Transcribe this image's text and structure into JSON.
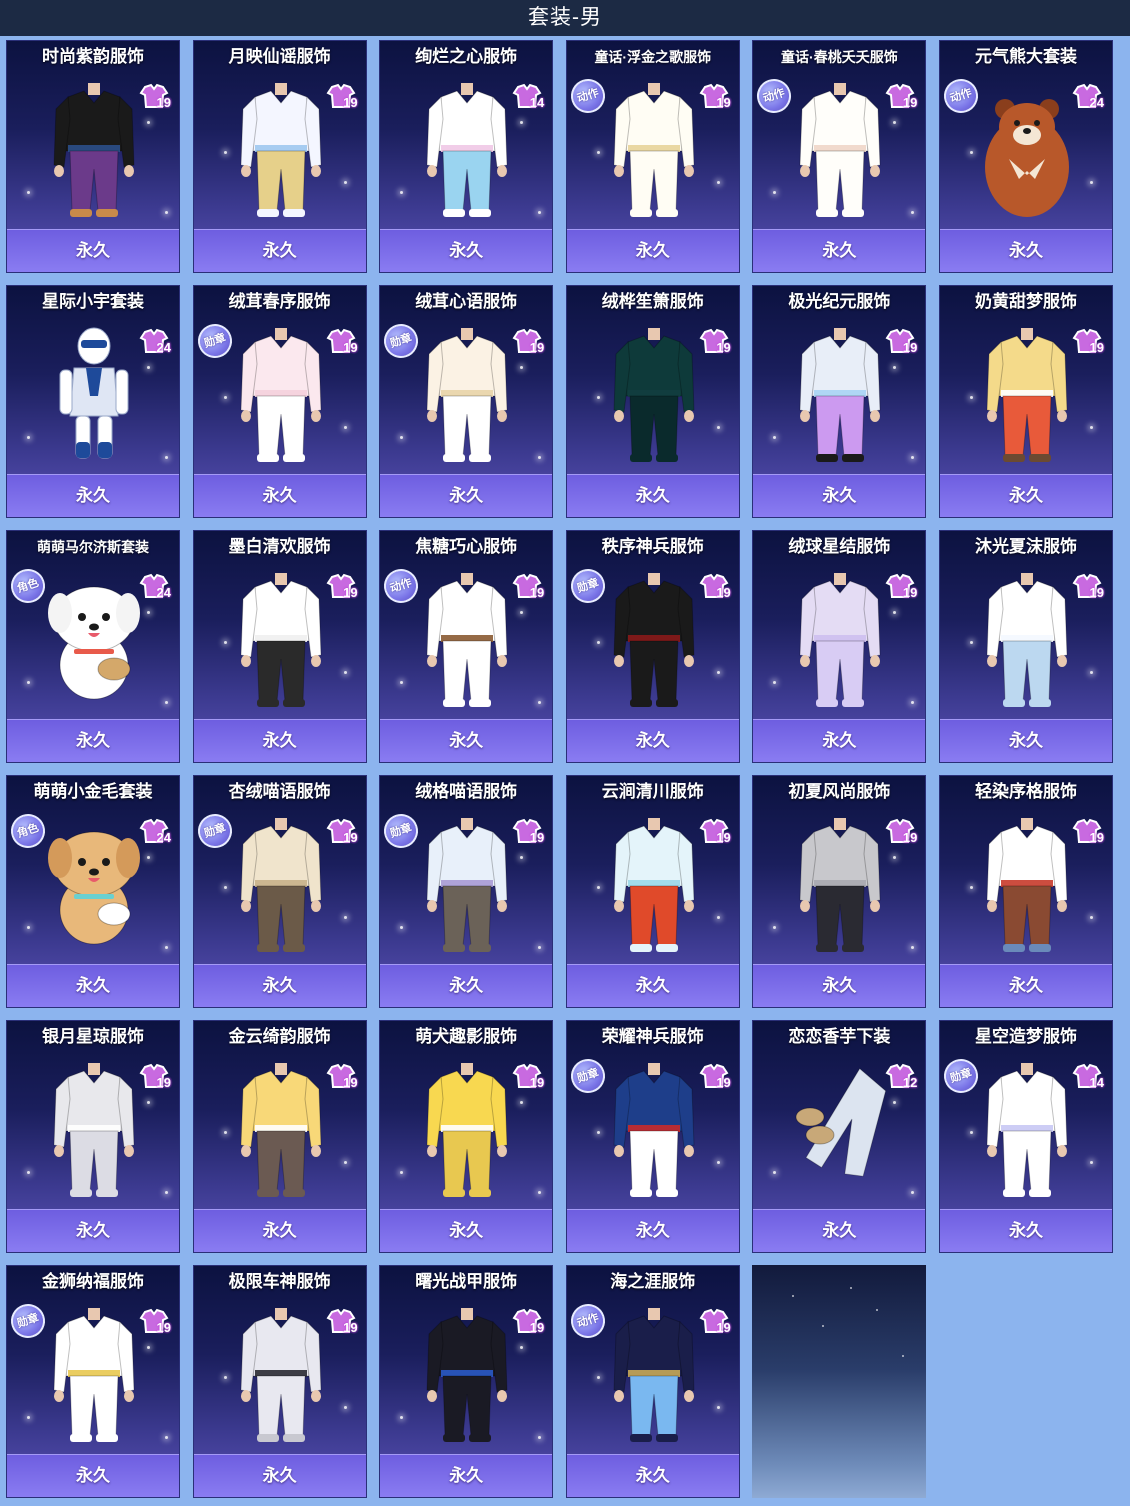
{
  "header": {
    "title": "套装-男"
  },
  "colors": {
    "background": "#8cb4ee",
    "header": "#1c2a44",
    "card_top": "#0c1240",
    "card_bottom": "#5a52b4",
    "footer": "#7d6ee8"
  },
  "items": [
    {
      "name": "时尚紫韵服饰",
      "level": "19",
      "badge": "",
      "status": "永久",
      "colors": [
        "#1a1a1a",
        "#2b4f8a",
        "#6b3a8a",
        "#c98a4a"
      ],
      "icon": "outfit-icon"
    },
    {
      "name": "月映仙谣服饰",
      "level": "19",
      "badge": "",
      "status": "永久",
      "colors": [
        "#f4f6ff",
        "#9fc8f0",
        "#e6d08a",
        "#f4f6ff"
      ],
      "icon": "outfit-icon"
    },
    {
      "name": "绚烂之心服饰",
      "level": "14",
      "badge": "",
      "status": "永久",
      "colors": [
        "#ffffff",
        "#f0c8e6",
        "#9ad4f0",
        "#ffffff"
      ],
      "icon": "outfit-icon"
    },
    {
      "name": "童话·浮金之歌服饰",
      "level": "19",
      "badge": "动作",
      "status": "永久",
      "colors": [
        "#fffdf4",
        "#e8d49a",
        "#fffdf4",
        "#fffdf4"
      ],
      "icon": "outfit-icon"
    },
    {
      "name": "童话·春桃夭夭服饰",
      "level": "19",
      "badge": "动作",
      "status": "永久",
      "colors": [
        "#fffefa",
        "#f0d6c8",
        "#fffefa",
        "#fffefa"
      ],
      "icon": "outfit-icon"
    },
    {
      "name": "元气熊大套装",
      "level": "24",
      "badge": "动作",
      "status": "永久",
      "colors": [
        "#b8582a",
        "#f4e6d4",
        "#8a3e1c",
        "#8a3e1c"
      ],
      "icon": "bear-icon"
    },
    {
      "name": "星际小宇套装",
      "level": "24",
      "badge": "",
      "status": "永久",
      "colors": [
        "#ffffff",
        "#1e4a9a",
        "#dfe6f4",
        "#1e4a9a"
      ],
      "icon": "robot-icon"
    },
    {
      "name": "绒茸春序服饰",
      "level": "19",
      "badge": "勋章",
      "status": "永久",
      "colors": [
        "#fbe8ee",
        "#f4d0dc",
        "#ffffff",
        "#ffffff"
      ],
      "icon": "outfit-icon"
    },
    {
      "name": "绒茸心语服饰",
      "level": "19",
      "badge": "勋章",
      "status": "永久",
      "colors": [
        "#fbf2e4",
        "#e8d4a8",
        "#ffffff",
        "#ffffff"
      ],
      "icon": "outfit-icon"
    },
    {
      "name": "绒桦笙箫服饰",
      "level": "19",
      "badge": "",
      "status": "永久",
      "colors": [
        "#0e3a3a",
        "#123e40",
        "#0a2a2c",
        "#0a2a2c"
      ],
      "icon": "outfit-icon"
    },
    {
      "name": "极光纪元服饰",
      "level": "19",
      "badge": "",
      "status": "永久",
      "colors": [
        "#e8eef8",
        "#a8d4f4",
        "#cc9af0",
        "#1a1a1a"
      ],
      "icon": "outfit-icon"
    },
    {
      "name": "奶黄甜梦服饰",
      "level": "19",
      "badge": "",
      "status": "永久",
      "colors": [
        "#f4da8a",
        "#ffffff",
        "#e85a3a",
        "#6b4a32"
      ],
      "icon": "outfit-icon"
    },
    {
      "name": "萌萌马尔济斯套装",
      "level": "24",
      "badge": "角色",
      "status": "永久",
      "colors": [
        "#ffffff",
        "#f4f4f4",
        "#e85a4a",
        "#d4a86a"
      ],
      "icon": "dog-icon"
    },
    {
      "name": "墨白清欢服饰",
      "level": "19",
      "badge": "",
      "status": "永久",
      "colors": [
        "#ffffff",
        "#f0f0f0",
        "#2a2a2a",
        "#2a2a2a"
      ],
      "icon": "outfit-icon"
    },
    {
      "name": "焦糖巧心服饰",
      "level": "19",
      "badge": "动作",
      "status": "永久",
      "colors": [
        "#ffffff",
        "#8a5a32",
        "#ffffff",
        "#ffffff"
      ],
      "icon": "outfit-icon"
    },
    {
      "name": "秩序神兵服饰",
      "level": "19",
      "badge": "勋章",
      "status": "永久",
      "colors": [
        "#1a1a1a",
        "#8a1a1a",
        "#1a1a1a",
        "#1a1a1a"
      ],
      "icon": "outfit-icon"
    },
    {
      "name": "绒球星结服饰",
      "level": "19",
      "badge": "",
      "status": "永久",
      "colors": [
        "#e4dcf4",
        "#cdbff0",
        "#d8ccf4",
        "#d8ccf4"
      ],
      "icon": "outfit-icon"
    },
    {
      "name": "沐光夏沫服饰",
      "level": "19",
      "badge": "",
      "status": "永久",
      "colors": [
        "#ffffff",
        "#f4f8ff",
        "#bcd8f0",
        "#bcd8f0"
      ],
      "icon": "outfit-icon"
    },
    {
      "name": "萌萌小金毛套装",
      "level": "24",
      "badge": "角色",
      "status": "永久",
      "colors": [
        "#e8b87a",
        "#d49a5a",
        "#6ad0d0",
        "#ffffff"
      ],
      "icon": "dog-icon"
    },
    {
      "name": "杏绒喵语服饰",
      "level": "19",
      "badge": "勋章",
      "status": "永久",
      "colors": [
        "#f0e4cc",
        "#c8b08a",
        "#6b5a48",
        "#6b5a48"
      ],
      "icon": "outfit-icon"
    },
    {
      "name": "绒格喵语服饰",
      "level": "19",
      "badge": "勋章",
      "status": "永久",
      "colors": [
        "#e8f0fa",
        "#a89ad4",
        "#6b6258",
        "#6b6258"
      ],
      "icon": "outfit-icon"
    },
    {
      "name": "云涧清川服饰",
      "level": "19",
      "badge": "",
      "status": "永久",
      "colors": [
        "#e4f4fa",
        "#9ad8e8",
        "#e04a2a",
        "#e4f4fa"
      ],
      "icon": "outfit-icon"
    },
    {
      "name": "初夏风尚服饰",
      "level": "19",
      "badge": "",
      "status": "永久",
      "colors": [
        "#c8c8cc",
        "#a8a8b0",
        "#2a2a32",
        "#2a2a32"
      ],
      "icon": "outfit-icon"
    },
    {
      "name": "轻染序格服饰",
      "level": "19",
      "badge": "",
      "status": "永久",
      "colors": [
        "#ffffff",
        "#c83a2a",
        "#8a4a32",
        "#6a8aba"
      ],
      "icon": "outfit-icon"
    },
    {
      "name": "银月星琼服饰",
      "level": "19",
      "badge": "",
      "status": "永久",
      "colors": [
        "#e8e8ec",
        "#ffffff",
        "#dcdce4",
        "#dcdce4"
      ],
      "icon": "outfit-icon"
    },
    {
      "name": "金云绮韵服饰",
      "level": "19",
      "badge": "",
      "status": "永久",
      "colors": [
        "#f8d878",
        "#ffffff",
        "#6b5a52",
        "#6b5a52"
      ],
      "icon": "outfit-icon"
    },
    {
      "name": "萌犬趣影服饰",
      "level": "19",
      "badge": "",
      "status": "永久",
      "colors": [
        "#f8d850",
        "#ffffff",
        "#e8c850",
        "#e8c850"
      ],
      "icon": "outfit-icon"
    },
    {
      "name": "荣耀神兵服饰",
      "level": "19",
      "badge": "勋章",
      "status": "永久",
      "colors": [
        "#1e3e8a",
        "#c82a2a",
        "#ffffff",
        "#ffffff"
      ],
      "icon": "outfit-icon"
    },
    {
      "name": "恋恋香芋下装",
      "level": "12",
      "badge": "",
      "status": "永久",
      "colors": [
        "#dce4f0",
        "#c8a878",
        "#dce4f0",
        "#c8a878"
      ],
      "icon": "pants-icon"
    },
    {
      "name": "星空造梦服饰",
      "level": "14",
      "badge": "勋章",
      "status": "永久",
      "colors": [
        "#ffffff",
        "#c8c8f4",
        "#ffffff",
        "#ffffff"
      ],
      "icon": "outfit-icon"
    },
    {
      "name": "金狮纳福服饰",
      "level": "19",
      "badge": "勋章",
      "status": "永久",
      "colors": [
        "#ffffff",
        "#e8c850",
        "#ffffff",
        "#ffffff"
      ],
      "icon": "outfit-icon"
    },
    {
      "name": "极限车神服饰",
      "level": "19",
      "badge": "",
      "status": "永久",
      "colors": [
        "#e8e8f0",
        "#2a2a32",
        "#e8e8f0",
        "#c8c8d0"
      ],
      "icon": "outfit-icon"
    },
    {
      "name": "曙光战甲服饰",
      "level": "19",
      "badge": "",
      "status": "永久",
      "colors": [
        "#1a1a24",
        "#2a5ac8",
        "#1a1a24",
        "#1a1a24"
      ],
      "icon": "outfit-icon"
    },
    {
      "name": "海之涯服饰",
      "level": "19",
      "badge": "动作",
      "status": "永久",
      "colors": [
        "#1a1e4a",
        "#c8a858",
        "#7ab8f0",
        "#1a1e4a"
      ],
      "icon": "outfit-icon"
    }
  ]
}
